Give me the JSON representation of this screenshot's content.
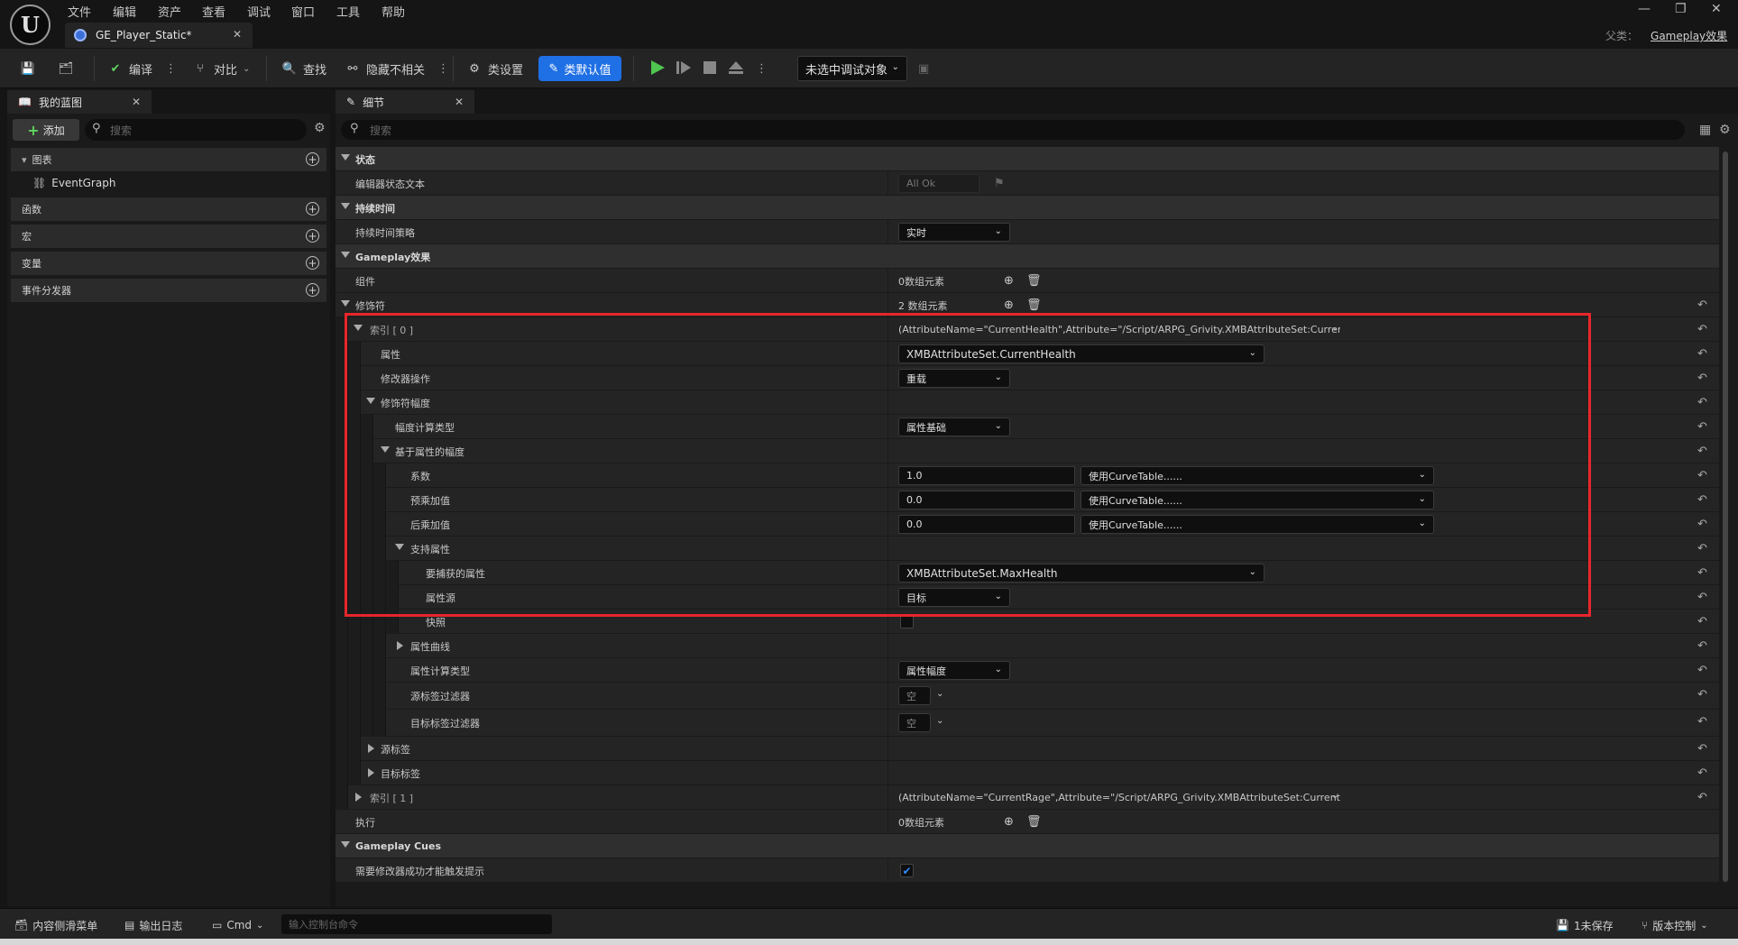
{
  "menu": [
    "文件",
    "编辑",
    "资产",
    "查看",
    "调试",
    "窗口",
    "工具",
    "帮助"
  ],
  "doc_tab": {
    "title": "GE_Player_Static*"
  },
  "parent_class": {
    "label": "父类：",
    "value": "Gameplay效果"
  },
  "toolbar": {
    "compile": "编译",
    "diff": "对比",
    "find": "查找",
    "hide_unrelated": "隐藏不相关",
    "class_settings": "类设置",
    "class_defaults": "类默认值",
    "debug_target": "未选中调试对象"
  },
  "left_panel": {
    "tab": "我的蓝图",
    "add": "添加",
    "search_placeholder": "搜索",
    "sections": {
      "graphs": "图表",
      "event_graph": "EventGraph",
      "functions": "函数",
      "macros": "宏",
      "variables": "变量",
      "dispatchers": "事件分发器"
    }
  },
  "details": {
    "tab": "细节",
    "search_placeholder": "搜索",
    "rows": {
      "status": "状态",
      "editor_status_text": "编辑器状态文本",
      "editor_status_value": "All Ok",
      "duration": "持续时间",
      "duration_policy": "持续时间策略",
      "duration_policy_value": "实时",
      "gameplay_effect": "Gameplay效果",
      "components": "组件",
      "components_value": "0数组元素",
      "modifiers": "修饰符",
      "modifiers_value": "2 数组元素",
      "index0": "索引 [ 0 ]",
      "index0_value": "(AttributeName=\"CurrentHealth\",Attribute=\"/Script/ARPG_Grivity.XMBAttributeSet:CurrentH",
      "attribute": "属性",
      "attribute_value": "XMBAttributeSet.CurrentHealth",
      "mod_op": "修改器操作",
      "mod_op_value": "重载",
      "mod_magnitude": "修饰符幅度",
      "magnitude_calc_type": "幅度计算类型",
      "magnitude_calc_type_value": "属性基础",
      "attr_based_magnitude": "基于属性的幅度",
      "coefficient": "系数",
      "coefficient_value": "1.0",
      "pre_mult": "预乘加值",
      "pre_mult_value": "0.0",
      "post_mult": "后乘加值",
      "post_mult_value": "0.0",
      "curve_table": "使用CurveTable......",
      "backing_attribute": "支持属性",
      "captured_attr": "要捕获的属性",
      "captured_attr_value": "XMBAttributeSet.MaxHealth",
      "attr_source": "属性源",
      "attr_source_value": "目标",
      "snapshot": "快照",
      "attr_curve": "属性曲线",
      "attr_calc_type": "属性计算类型",
      "attr_calc_type_value": "属性幅度",
      "source_tag_filter": "源标签过滤器",
      "target_tag_filter": "目标标签过滤器",
      "empty": "空",
      "source_tags": "源标签",
      "target_tags": "目标标签",
      "index1": "索引 [ 1 ]",
      "index1_value": "(AttributeName=\"CurrentRage\",Attribute=\"/Script/ARPG_Grivity.XMBAttributeSet:CurrentRa",
      "executions": "执行",
      "executions_value": "0数组元素",
      "gameplay_cues": "Gameplay Cues",
      "require_mod_success": "需要修改器成功才能触发提示"
    }
  },
  "statusbar": {
    "content_drawer": "内容侧滑菜单",
    "output_log": "输出日志",
    "cmd": "Cmd",
    "cmd_placeholder": "输入控制台命令",
    "unsaved": "1未保存",
    "source_control": "版本控制"
  },
  "colors": {
    "accent": "#1f6fe5",
    "highlight": "#e8262b",
    "play": "#4fc64f"
  }
}
